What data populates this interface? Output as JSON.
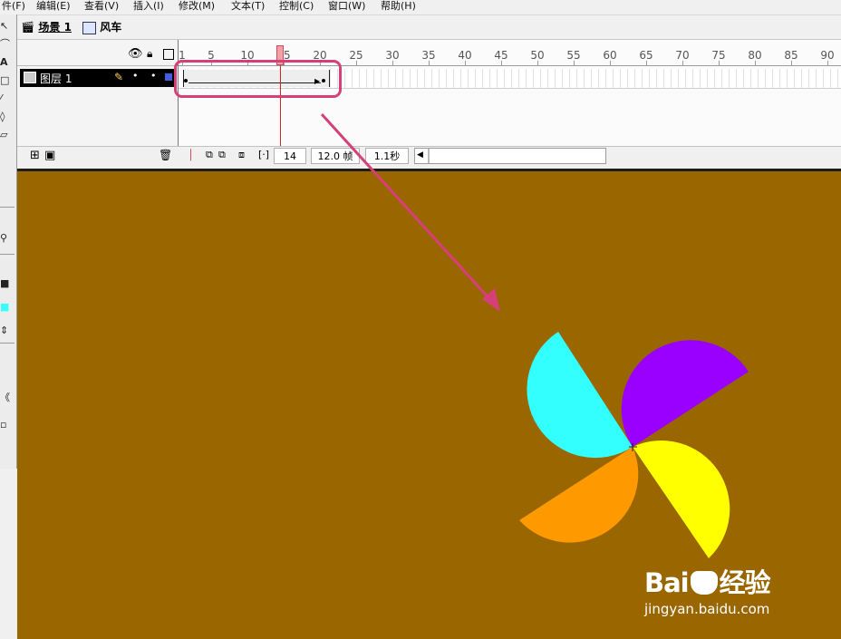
{
  "menu": [
    "件(F)",
    "编辑(E)",
    "查看(V)",
    "插入(I)",
    "修改(M)",
    "文本(T)",
    "控制(C)",
    "窗口(W)",
    "帮助(H)"
  ],
  "breadcrumb": {
    "scene": "场景 1",
    "symbol": "风车"
  },
  "timeline": {
    "layer_name": "图层 1",
    "ruler_labels": [
      "1",
      "5",
      "10",
      "15",
      "20",
      "25",
      "30",
      "35",
      "40",
      "45",
      "50",
      "55",
      "60",
      "65",
      "70",
      "75",
      "80",
      "85",
      "90"
    ],
    "current_frame": "14",
    "frame_rate": "12.0 帧",
    "elapsed_time": "1.1秒"
  },
  "stage": {
    "background": "#996600"
  },
  "pinwheel_colors": {
    "top_left": "#33ffff",
    "top_right": "#9900ff",
    "bottom_right": "#ffff00",
    "bottom_left": "#ff9900"
  },
  "annotation": {
    "color": "#d63f78"
  },
  "watermark": {
    "logo": "Bai",
    "brand": "经验",
    "url": "jingyan.baidu.com"
  }
}
